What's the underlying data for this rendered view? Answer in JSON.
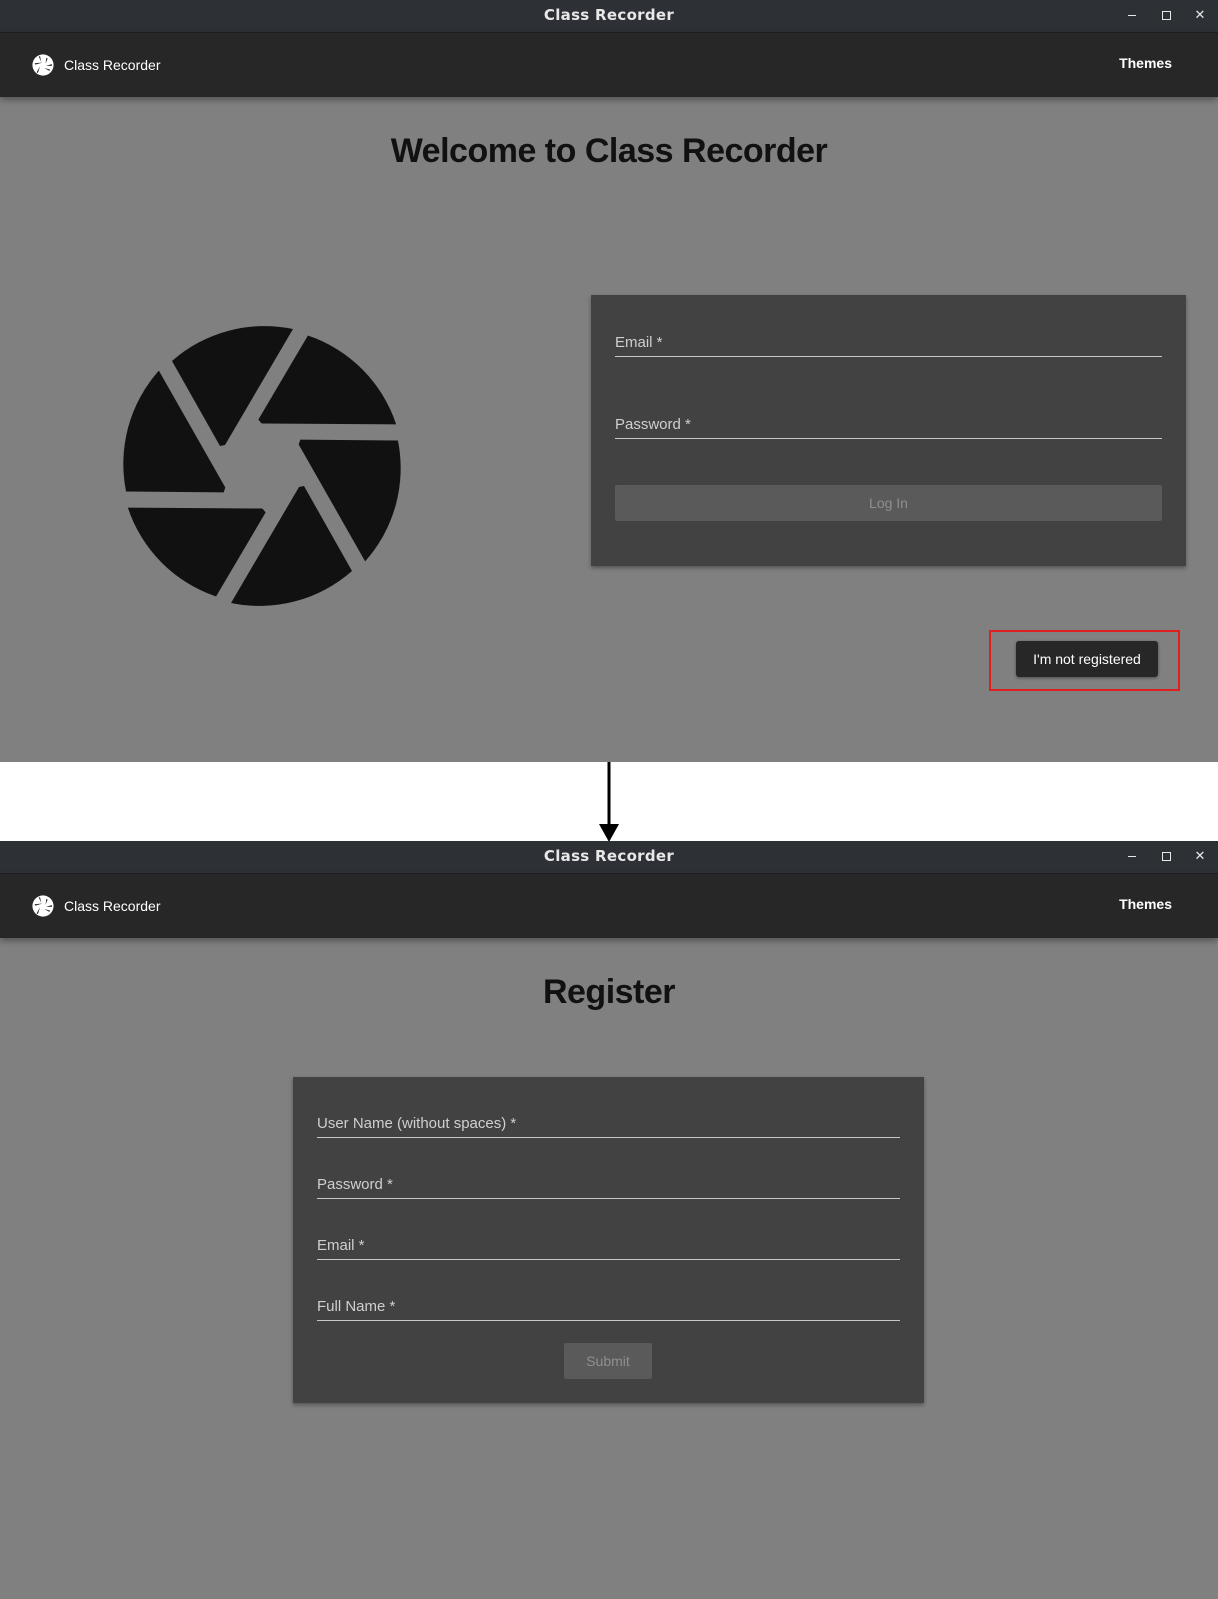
{
  "login_window": {
    "title": "Class Recorder",
    "appbar": {
      "brand_name": "Class Recorder",
      "themes_label": "Themes"
    },
    "heading": "Welcome to Class Recorder",
    "form": {
      "email_label": "Email *",
      "password_label": "Password *",
      "login_label": "Log In"
    },
    "not_registered_label": "I'm not registered"
  },
  "register_window": {
    "title": "Class Recorder",
    "appbar": {
      "brand_name": "Class Recorder",
      "themes_label": "Themes"
    },
    "heading": "Register",
    "form": {
      "username_label": "User Name (without spaces) *",
      "password_label": "Password *",
      "email_label": "Email *",
      "fullname_label": "Full Name *",
      "submit_label": "Submit"
    }
  },
  "colors": {
    "window_bg": "#808080",
    "appbar_bg": "#272727",
    "titlebar_bg": "#2d3035",
    "card_bg": "#424242",
    "highlight": "#e01f1f"
  }
}
